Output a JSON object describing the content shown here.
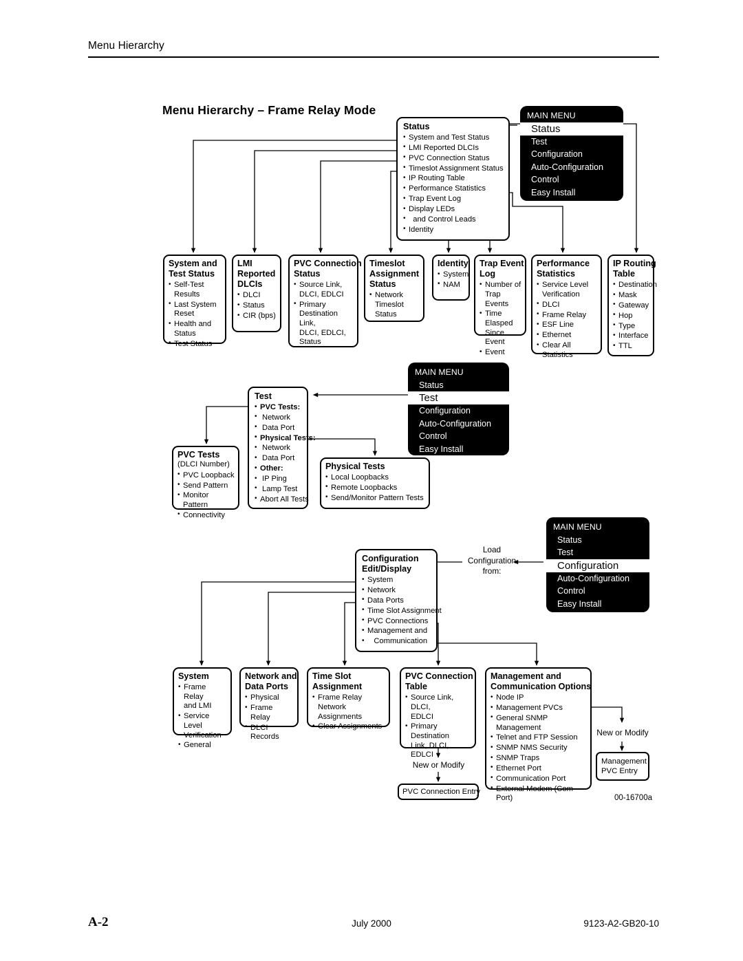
{
  "header": {
    "running_head": "Menu Hierarchy"
  },
  "footer": {
    "page_number": "A-2",
    "date": "July 2000",
    "doc_number": "9123-A2-GB20-10",
    "figure_id": "00-16700a"
  },
  "figure": {
    "title": "Menu Hierarchy – Frame Relay Mode"
  },
  "main_menu_status": {
    "title": "MAIN MENU",
    "items": [
      "Status",
      "Test",
      "Configuration",
      "Auto-Configuration",
      "Control",
      "Easy Install"
    ],
    "selected": "Status"
  },
  "main_menu_test": {
    "title": "MAIN MENU",
    "items": [
      "Status",
      "Test",
      "Configuration",
      "Auto-Configuration",
      "Control",
      "Easy Install"
    ],
    "selected": "Test"
  },
  "main_menu_config": {
    "title": "MAIN MENU",
    "items": [
      "Status",
      "Test",
      "Configuration",
      "Auto-Configuration",
      "Control",
      "Easy Install"
    ],
    "selected": "Configuration"
  },
  "status_menu": {
    "header": "Status",
    "items": [
      "System and Test Status",
      "LMI Reported DLCIs",
      "PVC Connection Status",
      "Timeslot Assignment Status",
      "IP Routing Table",
      "Performance Statistics",
      "Trap Event Log",
      "Display LEDs",
      "  and Control Leads",
      "Identity"
    ]
  },
  "status_boxes": {
    "system_test_status": {
      "header_l1": "System and",
      "header_l2": "Test Status",
      "items": [
        "Self-Test Results",
        "Last System\n   Reset",
        "Health and\n   Status",
        "Test Status"
      ]
    },
    "lmi_reported_dlcis": {
      "header_l1": "LMI",
      "header_l2": "Reported",
      "header_l3": "DLCIs",
      "items": [
        "DLCI",
        "Status",
        "CIR (bps)"
      ]
    },
    "pvc_connection_status": {
      "header_l1": "PVC Connection",
      "header_l2": "Status",
      "items": [
        "Source Link,\n   DLCI, EDLCI",
        "Primary\n   Destination   Link,\n   DLCI, EDLCI,\n   Status"
      ]
    },
    "timeslot_assignment_status": {
      "header_l1": "Timeslot",
      "header_l2": "Assignment",
      "header_l3": "Status",
      "items": [
        "Network Timeslot\n   Status"
      ]
    },
    "identity": {
      "header_l1": "Identity",
      "items": [
        "System",
        "NAM"
      ]
    },
    "trap_event_log": {
      "header_l1": "Trap Event",
      "header_l2": "Log",
      "items": [
        "Number of\n   Trap Events",
        "Time Elasped\n   Since Event",
        "Event"
      ]
    },
    "performance_statistics": {
      "header_l1": "Performance",
      "header_l2": "Statistics",
      "items": [
        "Service Level\n   Verification",
        "DLCI",
        "Frame Relay",
        "ESF Line",
        "Ethernet",
        "Clear All Statistics"
      ]
    },
    "ip_routing_table": {
      "header_l1": "IP Routing",
      "header_l2": "Table",
      "items": [
        "Destination",
        "Mask",
        "Gateway",
        "Hop",
        "Type",
        "Interface",
        "TTL"
      ]
    }
  },
  "test_menu": {
    "header": "Test",
    "lines": [
      {
        "text": "PVC Tests:",
        "bold": true,
        "indent": 0
      },
      {
        "text": "Network",
        "bold": false,
        "indent": 1
      },
      {
        "text": "Data Port",
        "bold": false,
        "indent": 1
      },
      {
        "text": "Physical Tests:",
        "bold": true,
        "indent": 0
      },
      {
        "text": "Network",
        "bold": false,
        "indent": 1
      },
      {
        "text": "Data Port",
        "bold": false,
        "indent": 1
      },
      {
        "text": "Other:",
        "bold": true,
        "indent": 0
      },
      {
        "text": "IP Ping",
        "bold": false,
        "indent": 1
      },
      {
        "text": "Lamp Test",
        "bold": false,
        "indent": 1
      },
      {
        "text": "Abort All Tests",
        "bold": false,
        "indent": 0
      }
    ]
  },
  "test_boxes": {
    "pvc_tests": {
      "header": "PVC Tests",
      "sub": "(DLCI Number)",
      "items": [
        "PVC Loopback",
        "Send Pattern",
        "Monitor Pattern",
        "Connectivity"
      ]
    },
    "physical_tests": {
      "header": "Physical Tests",
      "items": [
        "Local Loopbacks",
        "Remote Loopbacks",
        "Send/Monitor Pattern Tests"
      ]
    }
  },
  "config_menu": {
    "header_l1": "Configuration",
    "header_l2": "Edit/Display",
    "items": [
      "System",
      "Network",
      "Data Ports",
      "Time Slot Assignment",
      "PVC Connections",
      "Management and",
      "   Communication"
    ]
  },
  "load_config_label": "Load\nConfiguration\nfrom:",
  "config_boxes": {
    "system": {
      "header": "System",
      "items": [
        "Frame Relay\n   and LMI",
        "Service Level\n   Verification",
        "General"
      ]
    },
    "network_data_ports": {
      "header_l1": "Network and",
      "header_l2": "Data Ports",
      "items": [
        "Physical",
        "Frame Relay",
        "DLCI Records"
      ]
    },
    "time_slot_assignment": {
      "header_l1": "Time Slot",
      "header_l2": "Assignment",
      "items": [
        "Frame Relay Network\n   Assignments",
        "Clear Assignments"
      ]
    },
    "pvc_connection_table": {
      "header_l1": "PVC Connection",
      "header_l2": "Table",
      "items": [
        "Source Link, DLCI,\n   EDLCI",
        "Primary Destination\n   Link,  DLCI,\n   EDLCI"
      ]
    },
    "management_communication": {
      "header_l1": "Management and",
      "header_l2": "Communication Options",
      "items": [
        "Node IP",
        "Management PVCs",
        "General SNMP Management",
        "Telnet and FTP Session",
        "SNMP NMS Security",
        "SNMP Traps",
        "Ethernet Port",
        "Communication Port",
        "External Modem (Com Port)"
      ]
    },
    "pvc_connection_entry": {
      "label": "PVC Connection Entry",
      "arrow_label": "New or Modify"
    },
    "management_pvc_entry": {
      "label_l1": "Management",
      "label_l2": "PVC Entry",
      "arrow_label": "New or Modify"
    }
  }
}
